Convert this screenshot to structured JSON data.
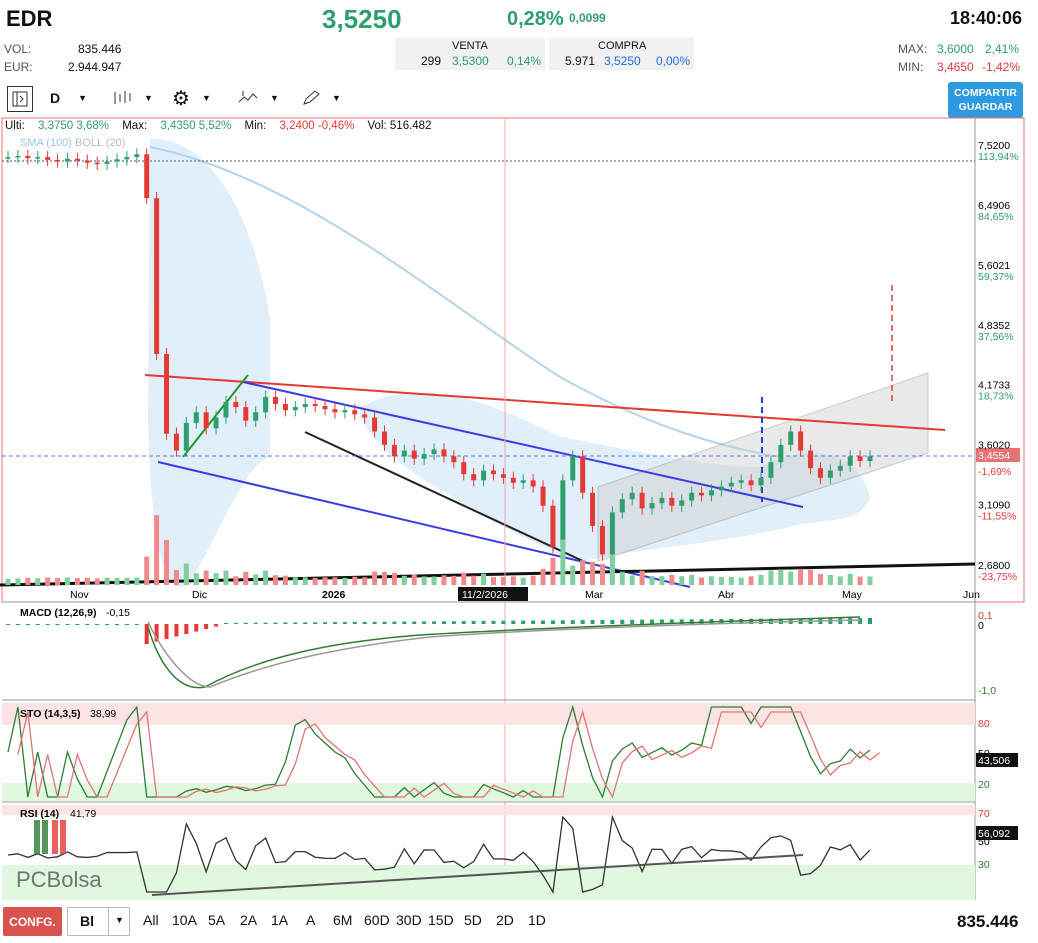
{
  "header": {
    "symbol": "EDR",
    "last": "3,5250",
    "change_pct": "0,28%",
    "change_abs": "0,0099",
    "time": "18:40:06",
    "vol_label": "VOL:",
    "vol_value": "835.446",
    "eur_label": "EUR:",
    "eur_value": "2.944.947",
    "venta_label": "VENTA",
    "venta_qty": "299",
    "venta_price": "3,5300",
    "venta_pct": "0,14%",
    "compra_label": "COMPRA",
    "compra_qty": "5.971",
    "compra_price": "3,5250",
    "compra_pct": "0,00%",
    "max_label": "MAX:",
    "max_value": "3,6000",
    "max_pct": "2,41%",
    "min_label": "MIN:",
    "min_value": "3,4650",
    "min_pct": "-1,42%"
  },
  "toolbar": {
    "period": "D",
    "share_label_1": "COMPARTIR",
    "share_label_2": "GUARDAR"
  },
  "info_line": {
    "ulti_label": "Ulti:",
    "ulti_value": "3,3750",
    "ulti_pct": "3,68%",
    "max_label": "Max:",
    "max_value": "3,4350",
    "max_pct": "5,52%",
    "min_label": "Min:",
    "min_value": "3,2400",
    "min_pct": "-0,46%",
    "vol_label": "Vol:",
    "vol_value": "516.482",
    "sma_label": "SMA (100)",
    "boll_label": "BOLL (20)"
  },
  "chart_data": [
    {
      "type": "line",
      "panel": "price",
      "x_ticks": [
        "Nov",
        "Dic",
        "2026",
        "Mar",
        "Abr",
        "May",
        "Jun"
      ],
      "crosshair_date": "11/2/2026",
      "y_ticks": [
        {
          "value": "7,5200",
          "pct": "113,94%"
        },
        {
          "value": "6,4906",
          "pct": "84,65%"
        },
        {
          "value": "5,6021",
          "pct": "59,37%"
        },
        {
          "value": "4,8352",
          "pct": "37,56%"
        },
        {
          "value": "4,1733",
          "pct": "18,73%"
        },
        {
          "value": "3,6020",
          "pct": ""
        },
        {
          "value": "3,1090",
          "pct": "-11,55%"
        },
        {
          "value": "2,6800",
          "pct": "-23,75%"
        }
      ],
      "current_value": "3,4554",
      "current_pct": "-1,69%",
      "y_scale": "log",
      "ylim": [
        2.68,
        7.52
      ],
      "close_series": [
        7.3,
        7.32,
        7.28,
        7.3,
        7.25,
        7.22,
        7.27,
        7.24,
        7.2,
        7.18,
        7.22,
        7.26,
        7.3,
        7.35,
        6.6,
        4.5,
        3.7,
        3.55,
        3.8,
        3.9,
        3.75,
        3.85,
        4.0,
        3.95,
        3.82,
        3.9,
        4.05,
        3.98,
        3.92,
        3.95,
        3.98,
        3.96,
        3.93,
        3.9,
        3.92,
        3.88,
        3.85,
        3.72,
        3.6,
        3.5,
        3.55,
        3.48,
        3.52,
        3.56,
        3.5,
        3.45,
        3.35,
        3.3,
        3.38,
        3.35,
        3.32,
        3.28,
        3.3,
        3.25,
        3.1,
        2.8,
        3.3,
        3.5,
        3.2,
        2.95,
        2.75,
        3.05,
        3.15,
        3.2,
        3.08,
        3.12,
        3.16,
        3.1,
        3.14,
        3.2,
        3.18,
        3.22,
        3.25,
        3.28,
        3.3,
        3.26,
        3.32,
        3.45,
        3.6,
        3.72,
        3.55,
        3.4,
        3.32,
        3.38,
        3.42,
        3.5,
        3.46,
        3.5
      ]
    },
    {
      "type": "bar",
      "panel": "macd",
      "title": "MACD (12,26,9)",
      "value": "-0,15",
      "y_ticks": [
        "0,1",
        "0",
        "-1,0"
      ]
    },
    {
      "type": "line",
      "panel": "stochastic",
      "title": "STO (14,3,5)",
      "value": "38,99",
      "y_ticks": [
        "80",
        "50",
        "20"
      ],
      "current_value": "43,506"
    },
    {
      "type": "line",
      "panel": "rsi",
      "title": "RSI (14)",
      "value": "41,79",
      "y_ticks": [
        "70",
        "50",
        "30"
      ],
      "current_value": "56,092"
    }
  ],
  "watermark": "PCBolsa",
  "bottom": {
    "config_label": "CONFG.",
    "select_value": "Bl",
    "ranges": [
      "All",
      "10A",
      "5A",
      "2A",
      "1A",
      "A",
      "6M",
      "60D",
      "30D",
      "15D",
      "5D",
      "2D",
      "1D"
    ],
    "total_volume": "835.446"
  }
}
